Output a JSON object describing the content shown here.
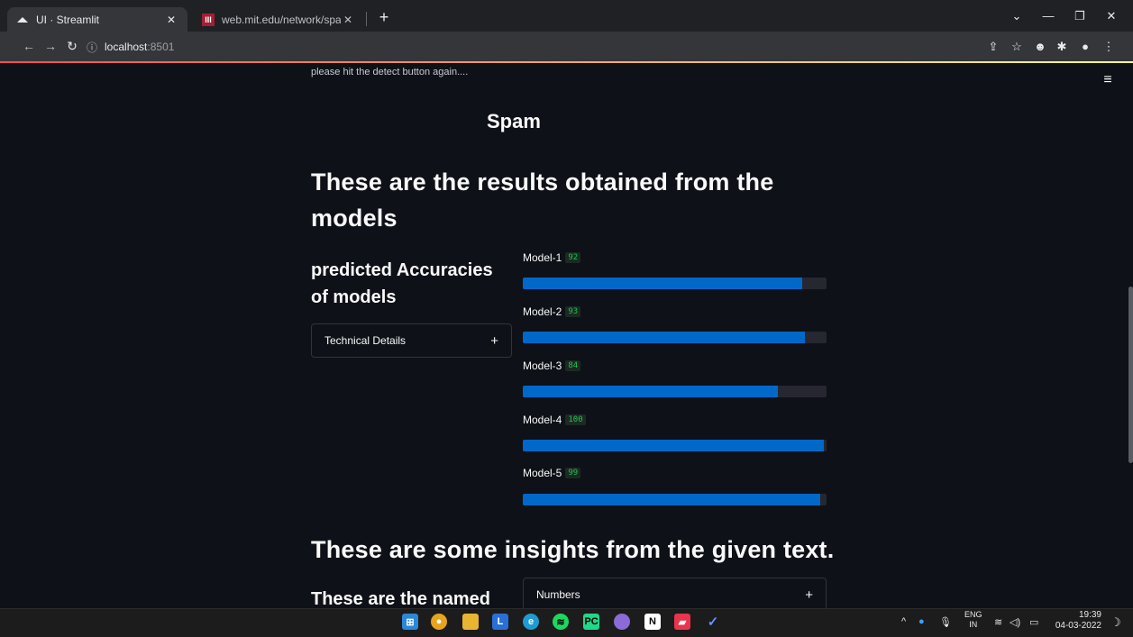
{
  "browser": {
    "tabs": [
      {
        "title": "UI · Streamlit",
        "active": true
      },
      {
        "title": "web.mit.edu/network/spam/exa",
        "active": false
      }
    ],
    "new_tab_label": "+",
    "address": {
      "host": "localhost",
      "port": ":8501"
    }
  },
  "page": {
    "previous_message": "please hit the detect button again....",
    "prediction_label": "Spam",
    "results_heading": "These are the results obtained from the models",
    "accuracy_heading": "predicted Accuracies of models",
    "technical_details_label": "Technical Details",
    "insights_heading": "These are some insights from the given text.",
    "named_heading": "These are the named",
    "numbers_expander_label": "Numbers",
    "expander_icon": "+"
  },
  "models": [
    {
      "label": "Model-1",
      "value": "92",
      "progress": 0.92
    },
    {
      "label": "Model-2",
      "value": "93",
      "progress": 0.93
    },
    {
      "label": "Model-3",
      "value": "84",
      "progress": 0.84
    },
    {
      "label": "Model-4",
      "value": "100",
      "progress": 0.99
    },
    {
      "label": "Model-5",
      "value": "99",
      "progress": 0.98
    }
  ],
  "taskbar": {
    "apps": [
      "windows-start-icon",
      "chrome-icon",
      "file-explorer-icon",
      "lightworks-icon",
      "edge-icon",
      "spotify-icon",
      "pycharm-icon",
      "github-desktop-icon",
      "notion-icon",
      "flashcards-icon",
      "todo-icon"
    ],
    "lang_top": "ENG",
    "lang_bottom": "IN",
    "time": "19:39",
    "date": "04-03-2022"
  },
  "colors": {
    "accent": "#0068c9",
    "background": "#0e1117",
    "metric_value": "#21c354"
  }
}
